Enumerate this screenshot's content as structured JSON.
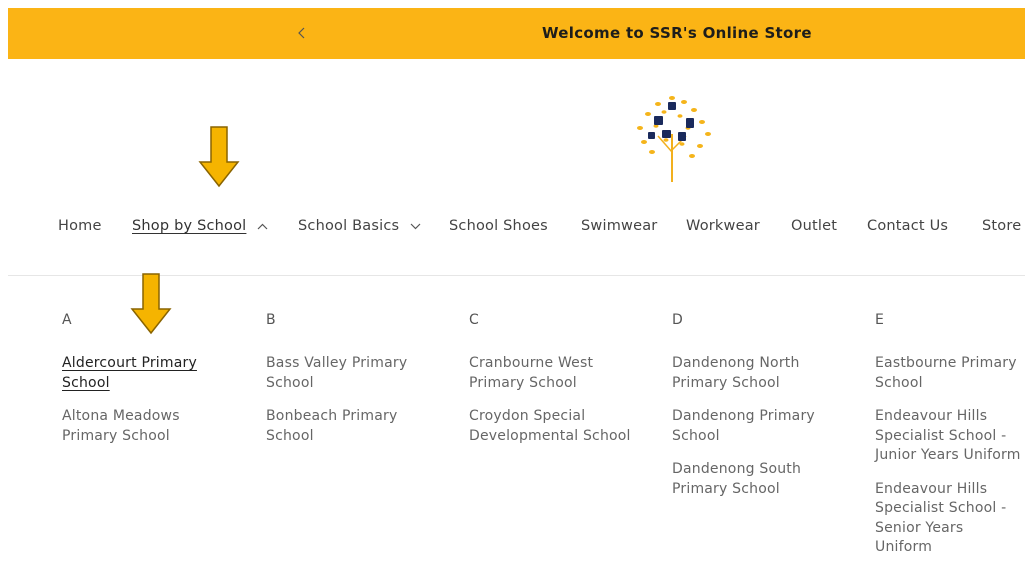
{
  "announcement": {
    "message": "Welcome to SSR's Online Store",
    "background": "#fbb415"
  },
  "logo": {
    "icon": "tree-logo-icon",
    "colors": [
      "#f5b41a",
      "#1a2a5c"
    ]
  },
  "nav": {
    "items": [
      {
        "label": "Home"
      },
      {
        "label": "Shop by School"
      },
      {
        "label": "School Basics"
      },
      {
        "label": "School Shoes"
      },
      {
        "label": "Swimwear"
      },
      {
        "label": "Workwear"
      },
      {
        "label": "Outlet"
      },
      {
        "label": "Contact Us"
      },
      {
        "label": "Store"
      }
    ]
  },
  "menu": {
    "columns": [
      {
        "letter": "A",
        "schools": [
          "Aldercourt Primary School",
          "Altona Meadows Primary School"
        ]
      },
      {
        "letter": "B",
        "schools": [
          "Bass Valley Primary School",
          "Bonbeach Primary School"
        ]
      },
      {
        "letter": "C",
        "schools": [
          "Cranbourne West Primary School",
          "Croydon Special Developmental School"
        ]
      },
      {
        "letter": "D",
        "schools": [
          "Dandenong North Primary School",
          "Dandenong Primary School",
          "Dandenong South Primary School"
        ]
      },
      {
        "letter": "E",
        "schools": [
          "Eastbourne Primary School",
          "Endeavour Hills Specialist School - Junior Years Uniform",
          "Endeavour Hills Specialist School - Senior Years Uniform"
        ]
      }
    ]
  },
  "annotation_color": "#f5b400"
}
